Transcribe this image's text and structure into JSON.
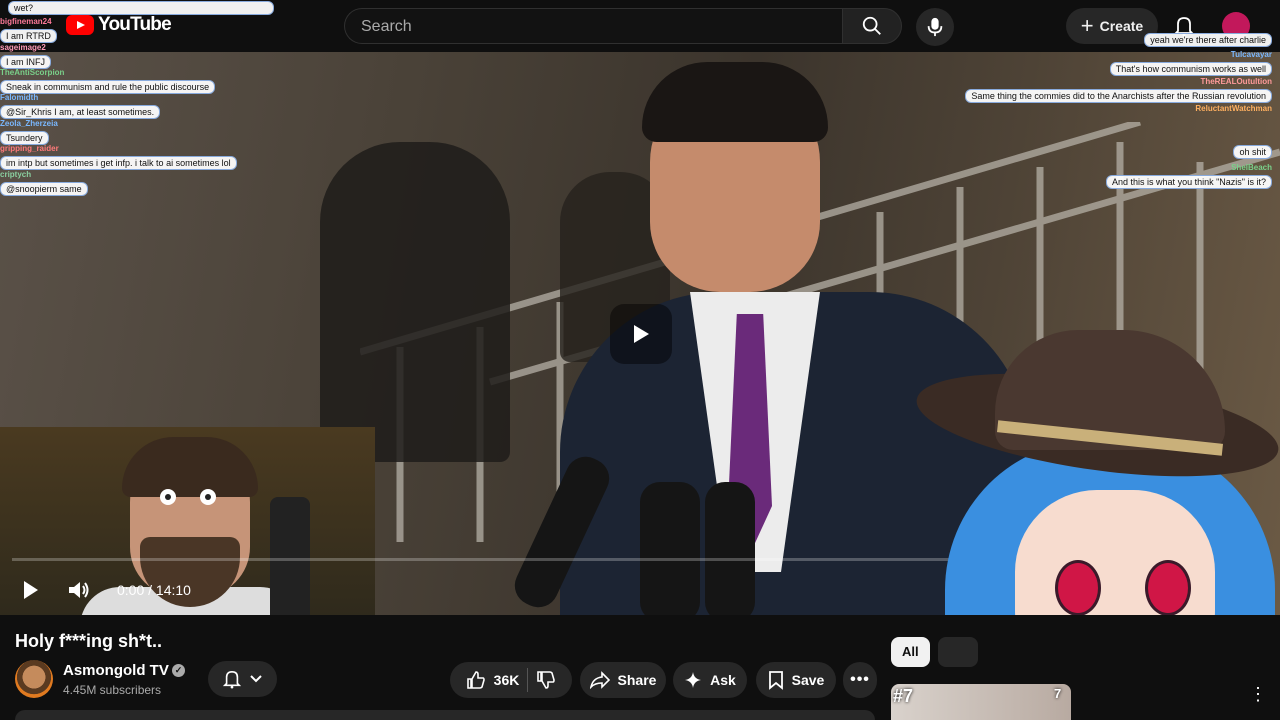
{
  "header": {
    "logo_text": "YouTube",
    "search_placeholder": "Search",
    "create_label": "Create",
    "brand_color": "#ff0000"
  },
  "player": {
    "time_display": "0:00 / 14:10",
    "progress_fraction": 0.0
  },
  "chat_left": [
    {
      "name": "",
      "text": "wet?"
    },
    {
      "name": "bigfineman24",
      "text": "I am RTRD"
    },
    {
      "name": "sageimage2",
      "text": "I am INFJ"
    },
    {
      "name": "TheAntiScorpion",
      "text": "Sneak in communism and rule the public discourse"
    },
    {
      "name": "Falomidth",
      "text": "@Sir_Khris I am, at least sometimes."
    },
    {
      "name": "Zeola_Zherzeia",
      "text": "Tsundery"
    },
    {
      "name": "gripping_raider",
      "text": "im intp but sometimes i get infp. i talk to ai sometimes lol"
    },
    {
      "name": "criptych",
      "text": "@snoopierm same"
    }
  ],
  "chat_right": [
    {
      "name": "",
      "text": "yeah we're there after charlie"
    },
    {
      "name": "Tulcavayar",
      "text": "That's how communism works as well"
    },
    {
      "name": "TheREALOutultion",
      "text": "Same thing the commies did to the Anarchists after the Russian revolution"
    },
    {
      "name": "ReluctantWatchman",
      "text": ""
    },
    {
      "name": "",
      "text": "oh shit"
    },
    {
      "name": "ShelBeach",
      "text": "And this is what you think \"Nazis\" is it?"
    }
  ],
  "video": {
    "title": "Holy f***ing sh*t..",
    "channel_name": "Asmongold TV",
    "subscribers": "4.45M subscribers"
  },
  "actions": {
    "like_count": "36K",
    "share_label": "Share",
    "ask_label": "Ask",
    "save_label": "Save"
  },
  "sidebar": {
    "chip_all": "All",
    "thumb_label": "#7",
    "thumb_label_2": "7"
  }
}
